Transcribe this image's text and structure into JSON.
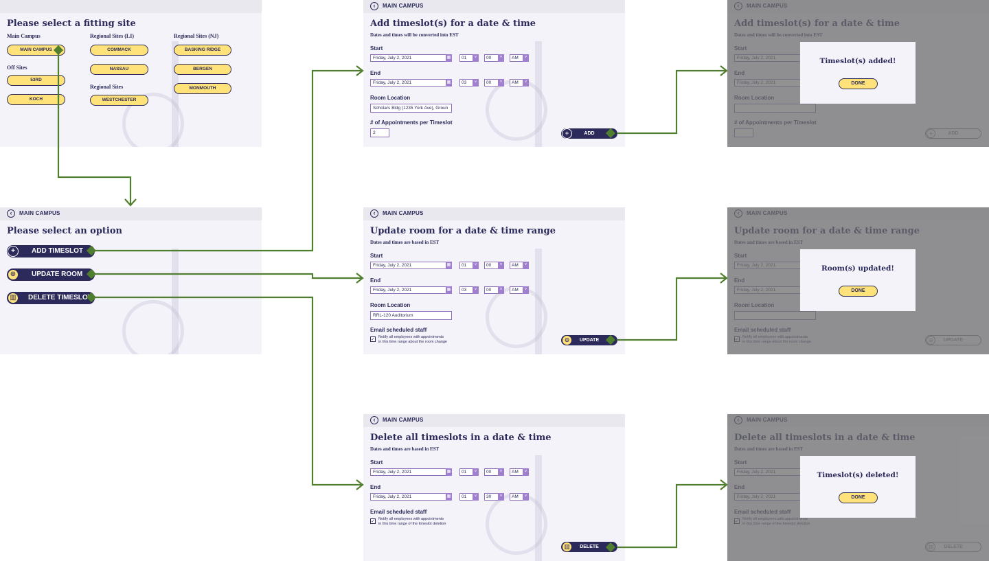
{
  "colors": {
    "navy": "#2b2a5a",
    "yellow": "#ffe27a",
    "purple": "#a17fcf",
    "arrow": "#4f7f2e",
    "bg": "#f4f3fa"
  },
  "site_screen": {
    "title": "Please select a fitting site",
    "groups": [
      {
        "name": "Main Campus",
        "sites": [
          "MAIN CAMPUS"
        ]
      },
      {
        "name": "Off Sites",
        "sites": [
          "53RD",
          "KOCH"
        ]
      },
      {
        "name": "Regional Sites (LI)",
        "sites": [
          "COMMACK",
          "NASSAU"
        ]
      },
      {
        "name": "Regional Sites",
        "sites": [
          "WESTCHESTER"
        ]
      },
      {
        "name": "Regional Sites (NJ)",
        "sites": [
          "BASKING RIDGE",
          "BERGEN",
          "MONMOUTH"
        ]
      }
    ]
  },
  "option_screen": {
    "crumb": "MAIN CAMPUS",
    "title": "Please select an option",
    "buttons": [
      "ADD TIMESLOT",
      "UPDATE ROOM",
      "DELETE TIMESLOT"
    ]
  },
  "add_screen": {
    "crumb": "MAIN CAMPUS",
    "title": "Add timeslot(s) for a date & time",
    "subtitle": "Dates and times will be converted into EST",
    "start_label": "Start",
    "start_date": "Friday, July 2, 2021",
    "start_hour": "01",
    "start_min": "00",
    "start_ampm": "AM",
    "end_label": "End",
    "end_date": "Friday, July 2, 2021",
    "end_hour": "03",
    "end_min": "00",
    "end_ampm": "AM",
    "room_label": "Room Location",
    "room_value": "Scholars Bldg (1235 York Ave), Groun",
    "appts_label": "# of Appointments per Timeslot",
    "appts_value": "2",
    "action": "ADD"
  },
  "update_screen": {
    "crumb": "MAIN CAMPUS",
    "title": "Update room for a date & time range",
    "subtitle": "Dates and times are based in EST",
    "start_label": "Start",
    "start_date": "Friday, July 2, 2021",
    "start_hour": "01",
    "start_min": "00",
    "start_ampm": "AM",
    "end_label": "End",
    "end_date": "Friday, July 2, 2021",
    "end_hour": "03",
    "end_min": "00",
    "end_ampm": "AM",
    "room_label": "Room Location",
    "room_value": "RRL-120 Auditorium",
    "email_label": "Email scheduled staff",
    "notify_text_1": "Notify all employees with appointments",
    "notify_text_2": "in this time range about the room change",
    "action": "UPDATE"
  },
  "delete_screen": {
    "crumb": "MAIN CAMPUS",
    "title": "Delete all timeslots in a date & time",
    "subtitle": "Dates and times are based in EST",
    "start_label": "Start",
    "start_date": "Friday, July 2, 2021",
    "start_hour": "01",
    "start_min": "00",
    "start_ampm": "AM",
    "end_label": "End",
    "end_date": "Friday, July 2, 2021",
    "end_hour": "01",
    "end_min": "30",
    "end_ampm": "AM",
    "email_label": "Email scheduled staff",
    "notify_text_1": "Notify all employees with appointments",
    "notify_text_2": "in this time range of the timeslot deletion",
    "action": "DELETE"
  },
  "confirm": {
    "added": "Timeslot(s) added!",
    "updated": "Room(s) updated!",
    "deleted": "Timeslot(s) deleted!",
    "done": "DONE"
  }
}
